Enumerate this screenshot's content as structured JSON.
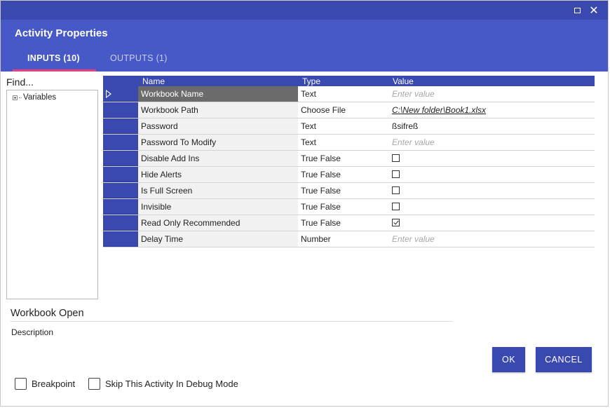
{
  "window": {
    "title": "Activity Properties",
    "maximize_icon": "maximize-icon",
    "close_icon": "close-icon",
    "close_glyph": "✕"
  },
  "tabs": [
    {
      "label": "INPUTS (10)",
      "active": true
    },
    {
      "label": "OUTPUTS (1)",
      "active": false
    }
  ],
  "left_panel": {
    "find_label": "Find...",
    "tree_items": [
      {
        "label": "Variables"
      }
    ]
  },
  "grid": {
    "columns": [
      "Name",
      "Type",
      "Value"
    ],
    "rows": [
      {
        "name": "Workbook Name",
        "type": "Text",
        "value": "",
        "placeholder": "Enter value",
        "kind": "text",
        "selected": true
      },
      {
        "name": "Workbook Path",
        "type": "Choose File",
        "value": "C:\\New folder\\Book1.xlsx",
        "kind": "link"
      },
      {
        "name": "Password",
        "type": "Text",
        "value": "ßsifreß",
        "kind": "text"
      },
      {
        "name": "Password To Modify",
        "type": "Text",
        "value": "",
        "placeholder": "Enter value",
        "kind": "text"
      },
      {
        "name": "Disable Add Ins",
        "type": "True False",
        "checked": false,
        "kind": "check"
      },
      {
        "name": "Hide Alerts",
        "type": "True False",
        "checked": false,
        "kind": "check"
      },
      {
        "name": "Is Full Screen",
        "type": "True False",
        "checked": false,
        "kind": "check"
      },
      {
        "name": "Invisible",
        "type": "True False",
        "checked": false,
        "kind": "check"
      },
      {
        "name": "Read Only Recommended",
        "type": "True False",
        "checked": true,
        "kind": "check"
      },
      {
        "name": "Delay Time",
        "type": "Number",
        "value": "",
        "placeholder": "Enter value",
        "kind": "text"
      }
    ]
  },
  "activity": {
    "name": "Workbook Open",
    "description_label": "Description"
  },
  "buttons": {
    "ok": "OK",
    "cancel": "CANCEL"
  },
  "options": {
    "breakpoint": {
      "label": "Breakpoint",
      "checked": false
    },
    "skip_debug": {
      "label": "Skip This Activity In Debug Mode",
      "checked": false
    }
  },
  "colors": {
    "title_bar": "#3a49b0",
    "header": "#4659c6",
    "accent_underline": "#e9407a",
    "selected_row": "#6b6b6b"
  }
}
